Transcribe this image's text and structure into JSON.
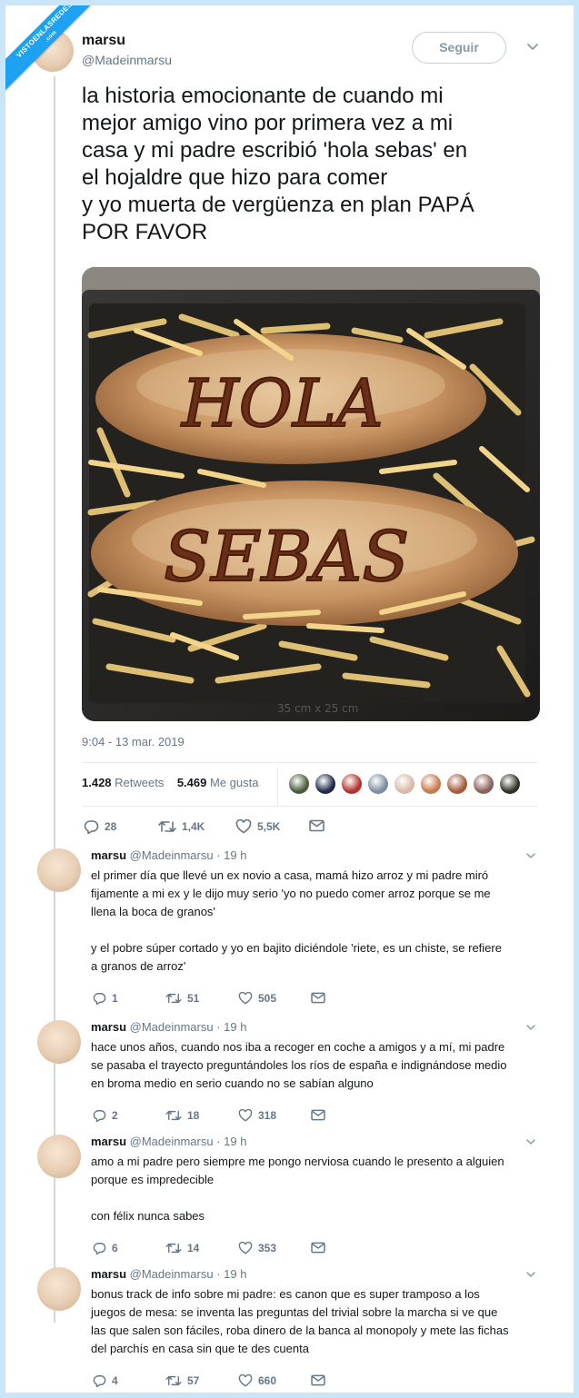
{
  "watermark": {
    "text": "VISTOENLASREDES",
    "sub": ".com"
  },
  "tweet": {
    "name": "marsu",
    "handle": "@Madeinmarsu",
    "follow_label": "Seguir",
    "text_lines": [
      "la historia emocionante de cuando mi",
      "mejor amigo vino por primera vez a mi",
      "casa y mi padre escribió 'hola sebas' en",
      "el hojaldre que hizo para comer",
      "y yo muerta de vergüenza en plan PAPÁ",
      "POR FAVOR"
    ],
    "photo": {
      "description_icon": "pastry-photo",
      "top_word": "HOLA",
      "bottom_word": "SEBAS",
      "tray_mark": "35 cm x 25 cm"
    },
    "timestamp": "9:04 - 13 mar. 2019",
    "retweets_count": "1.428",
    "retweets_label": "Retweets",
    "likes_count": "5.469",
    "likes_label": "Me gusta",
    "likers_colors": [
      "#4a5d3a",
      "#1c2a4a",
      "#b3312b",
      "#7a8fa3",
      "#d9b8a8",
      "#c77b4a",
      "#a55a3a",
      "#8a5f5a",
      "#2e3323"
    ],
    "actions": {
      "replies": "28",
      "retweets": "1,4K",
      "likes": "5,5K"
    }
  },
  "replies": [
    {
      "name": "marsu",
      "handle": "@Madeinmarsu · 19 h",
      "paragraphs": [
        [
          "el primer día que llevé un ex novio a casa, mamá hizo arroz y mi padre miró",
          "fijamente a mi ex y le dijo muy serio 'yo no puedo comer arroz porque se me",
          "llena la boca de granos'"
        ],
        [
          "y el pobre súper cortado y yo en bajito diciéndole 'riete, es un chiste, se refiere",
          "a granos de arroz'"
        ]
      ],
      "replies": "1",
      "retweets": "51",
      "likes": "505"
    },
    {
      "name": "marsu",
      "handle": "@Madeinmarsu · 19 h",
      "paragraphs": [
        [
          "hace unos años, cuando nos iba a recoger en coche a amigos y a mí, mi padre",
          "se pasaba el trayecto preguntándoles los ríos de españa e indignándose medio",
          "en broma medio en serio cuando no se sabían alguno"
        ]
      ],
      "replies": "2",
      "retweets": "18",
      "likes": "318"
    },
    {
      "name": "marsu",
      "handle": "@Madeinmarsu · 19 h",
      "paragraphs": [
        [
          "amo a mi padre pero siempre me pongo nerviosa cuando le presento a alguien",
          "porque es impredecible"
        ],
        [
          "con félix nunca sabes"
        ]
      ],
      "replies": "6",
      "retweets": "14",
      "likes": "353"
    },
    {
      "name": "marsu",
      "handle": "@Madeinmarsu · 19 h",
      "paragraphs": [
        [
          "bonus track de info sobre mi padre: es canon que es super tramposo a los",
          "juegos de mesa: se inventa las preguntas del trivial sobre la marcha si ve que",
          "las que salen son fáciles, roba dinero de la banca al monopoly y mete las fichas",
          "del parchís en casa sin que te des cuenta"
        ]
      ],
      "replies": "4",
      "retweets": "57",
      "likes": "660"
    }
  ]
}
